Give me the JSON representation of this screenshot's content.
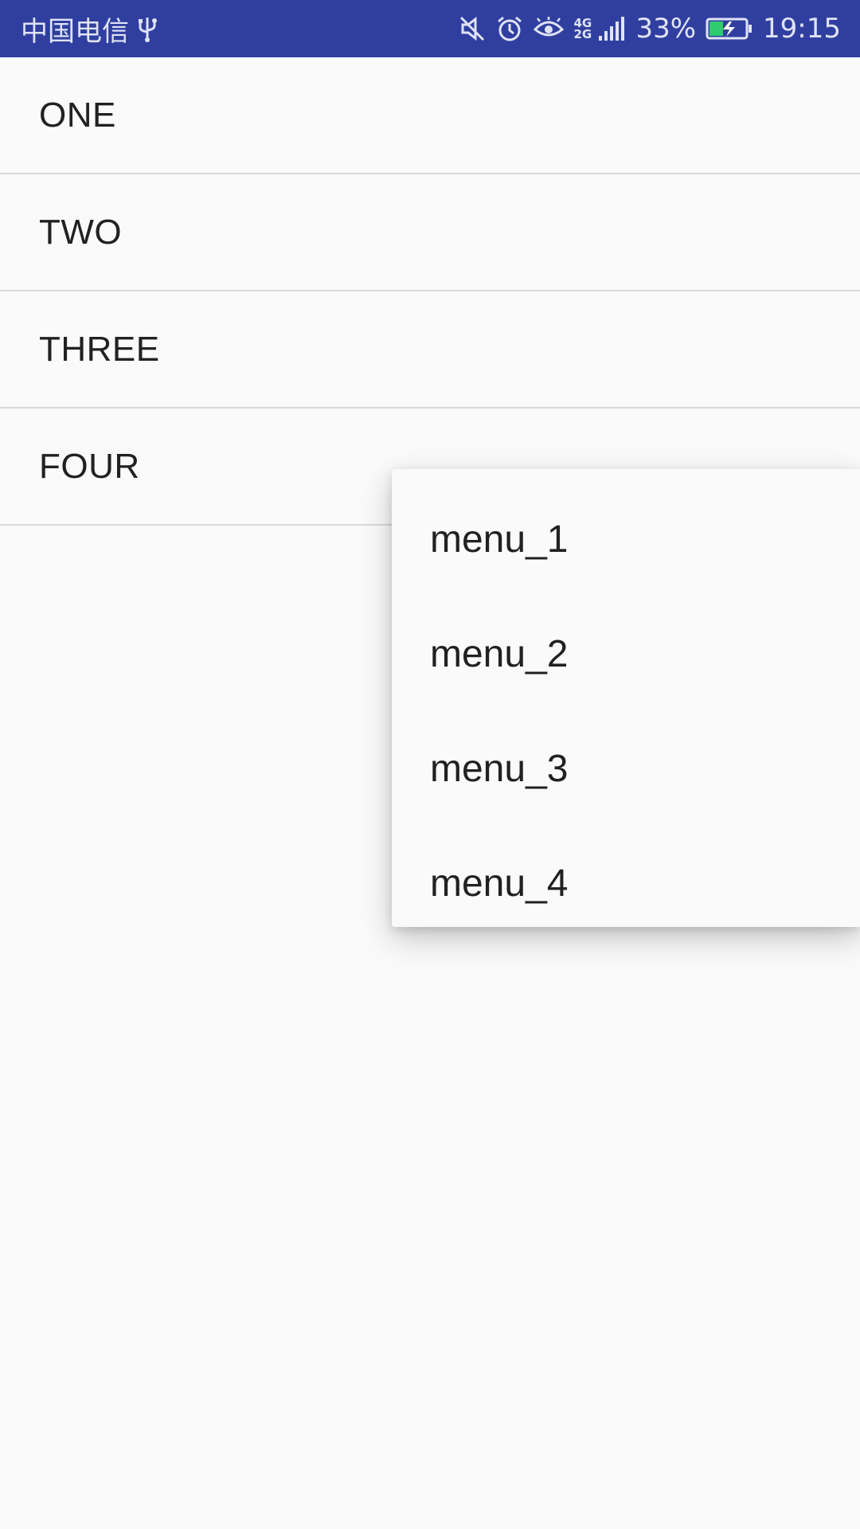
{
  "status_bar": {
    "carrier": "中国电信",
    "network": "4G\n2G",
    "battery_percent": "33%",
    "time": "19:15",
    "background_color": "#303f9f",
    "icons": [
      "usb-icon",
      "mute-icon",
      "alarm-icon",
      "eye-icon",
      "signal-icon",
      "battery-charging-icon"
    ]
  },
  "list": {
    "items": [
      {
        "label": "ONE"
      },
      {
        "label": "TWO"
      },
      {
        "label": "THREE"
      },
      {
        "label": "FOUR"
      }
    ]
  },
  "popup_menu": {
    "items": [
      {
        "label": "menu_1"
      },
      {
        "label": "menu_2"
      },
      {
        "label": "menu_3"
      },
      {
        "label": "menu_4"
      }
    ]
  }
}
